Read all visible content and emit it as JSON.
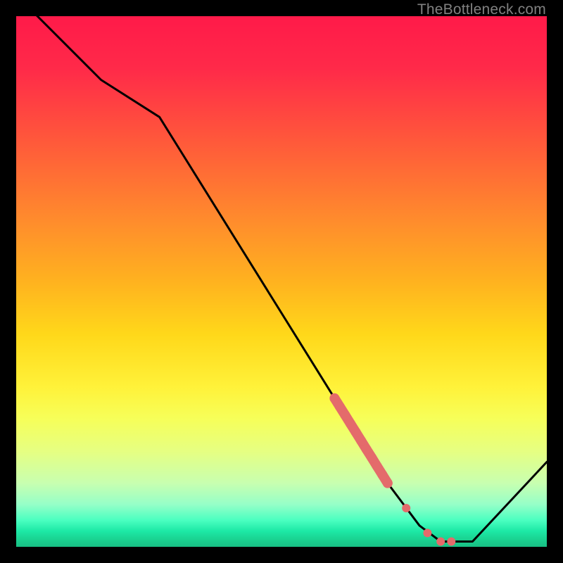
{
  "watermark": "TheBottleneck.com",
  "chart_data": {
    "type": "line",
    "title": "",
    "xlabel": "",
    "ylabel": "",
    "xlim": [
      0,
      100
    ],
    "ylim": [
      0,
      100
    ],
    "series": [
      {
        "name": "curve",
        "x": [
          0,
          16,
          27,
          60,
          70,
          76,
          80,
          86,
          100
        ],
        "values": [
          104,
          88,
          81,
          28,
          12,
          4,
          1,
          1,
          16
        ]
      }
    ],
    "markers_thick": [
      {
        "x": 60,
        "y": 28
      },
      {
        "x": 61,
        "y": 26.4
      },
      {
        "x": 62,
        "y": 24.8
      },
      {
        "x": 63,
        "y": 23.2
      },
      {
        "x": 64,
        "y": 21.6
      },
      {
        "x": 65,
        "y": 20
      },
      {
        "x": 66,
        "y": 18.4
      },
      {
        "x": 67,
        "y": 16.8
      },
      {
        "x": 68,
        "y": 15.2
      },
      {
        "x": 69,
        "y": 13.6
      },
      {
        "x": 70,
        "y": 12
      }
    ],
    "markers_small": [
      {
        "x": 73.5,
        "y": 7.3
      },
      {
        "x": 77.5,
        "y": 2.6
      },
      {
        "x": 80,
        "y": 1
      },
      {
        "x": 82,
        "y": 1
      }
    ],
    "colors": {
      "curve": "#000000",
      "marker": "#e46b6b",
      "gradient_top": "#ff1a49",
      "gradient_bottom": "#18bf84"
    }
  }
}
